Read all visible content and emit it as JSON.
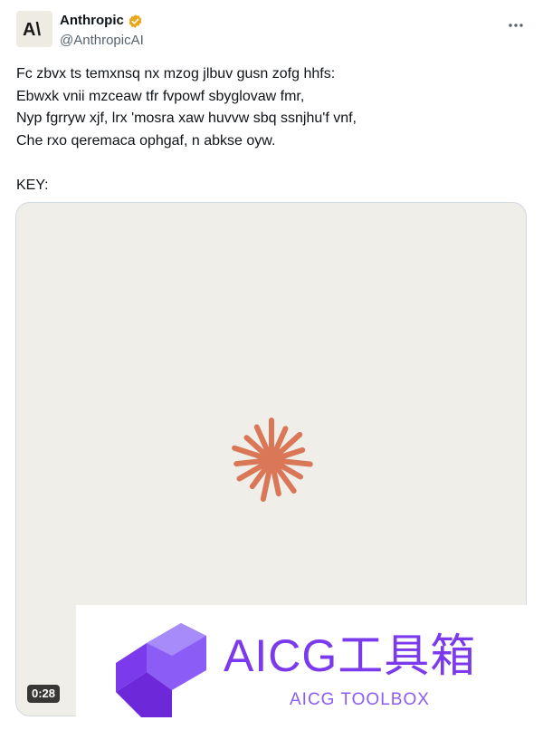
{
  "author": {
    "display_name": "Anthropic",
    "handle": "@AnthropicAI",
    "avatar_logo_text": "A\\",
    "verified_icon": "gold-verified-badge-icon",
    "verified_color": "#e8a81a"
  },
  "menu_icon": "more-horizontal-icon",
  "tweet": {
    "lines": [
      "Fc zbvx ts temxnsq nx mzog jlbuv gusn zofg hhfs:",
      "Ebwxk vnii mzceaw tfr fvpowf sbyglovaw fmr,",
      "Nyp fgrryw xjf, lrx 'mosra xaw huvvw sbq ssnjhu'f vnf,",
      "Che rxo qeremaca ophgaf, n abkse oyw."
    ],
    "key_label": "KEY:"
  },
  "media": {
    "background": "#f0eee9",
    "burst_color": "#d97757",
    "burst_icon": "anthropic-spark-icon",
    "duration": "0:28"
  },
  "watermark": {
    "title": "AICG工具箱",
    "subtitle": "AICG TOOLBOX",
    "color": "#7c3aed"
  }
}
